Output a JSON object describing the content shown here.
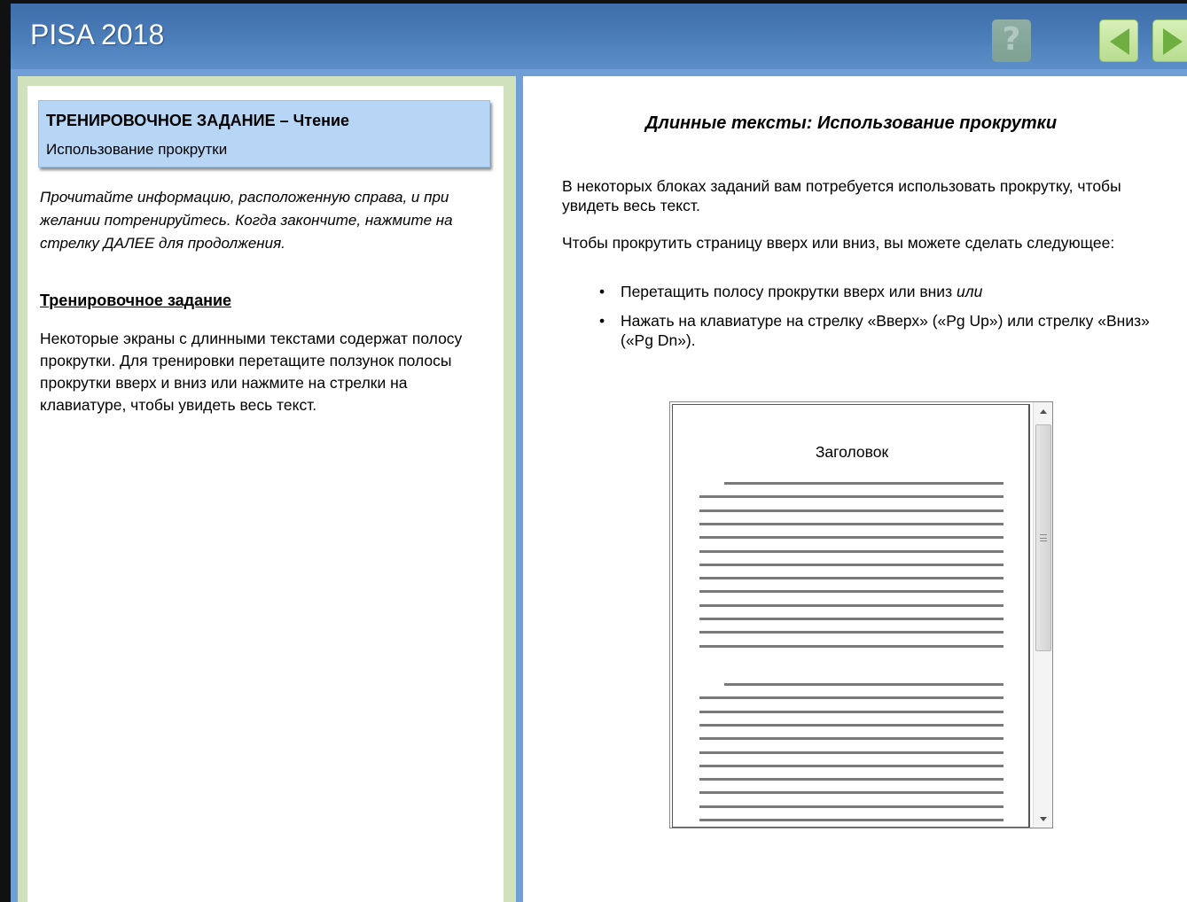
{
  "header": {
    "title": "PISA 2018",
    "help_label": "?",
    "prev_icon": "arrow-left-icon",
    "next_icon": "arrow-right-icon",
    "colors": {
      "header": "#4a7cb8",
      "nav_button": "#c8e6a4",
      "nav_arrow": "#6fae40",
      "accent_bar": "#6f9fd6"
    }
  },
  "left": {
    "task_title": "ТРЕНИРОВОЧНОЕ ЗАДАНИЕ – Чтение",
    "task_subtitle": "Использование прокрутки",
    "instruction": "Прочитайте информацию, расположенную справа, и при желании потренируйтесь. Когда закончите, нажмите на стрелку ДАЛЕЕ для продолжения.",
    "practice_heading": "Тренировочное задание",
    "practice_text": "Некоторые экраны с длинными текстами содержат полосу прокрутки. Для тренировки перетащите ползунок полосы прокрутки вверх и вниз или нажмите на стрелки на клавиатуре, чтобы увидеть весь текст."
  },
  "right": {
    "title": "Длинные тексты: Использование прокрутки",
    "paragraph1": "В некоторых блоках заданий вам потребуется использовать прокрутку, чтобы увидеть весь текст.",
    "paragraph2": "Чтобы прокрутить страницу вверх или вниз, вы можете сделать следующее:",
    "bullet1_text": "Перетащить полосу прокрутки вверх или вниз ",
    "bullet1_italic": "или",
    "bullet2_text": "Нажать на клавиатуре на стрелку «Вверх» («Pg Up») или стрелку «Вниз» («Pg Dn»).",
    "document": {
      "heading": "Заголовок"
    }
  }
}
